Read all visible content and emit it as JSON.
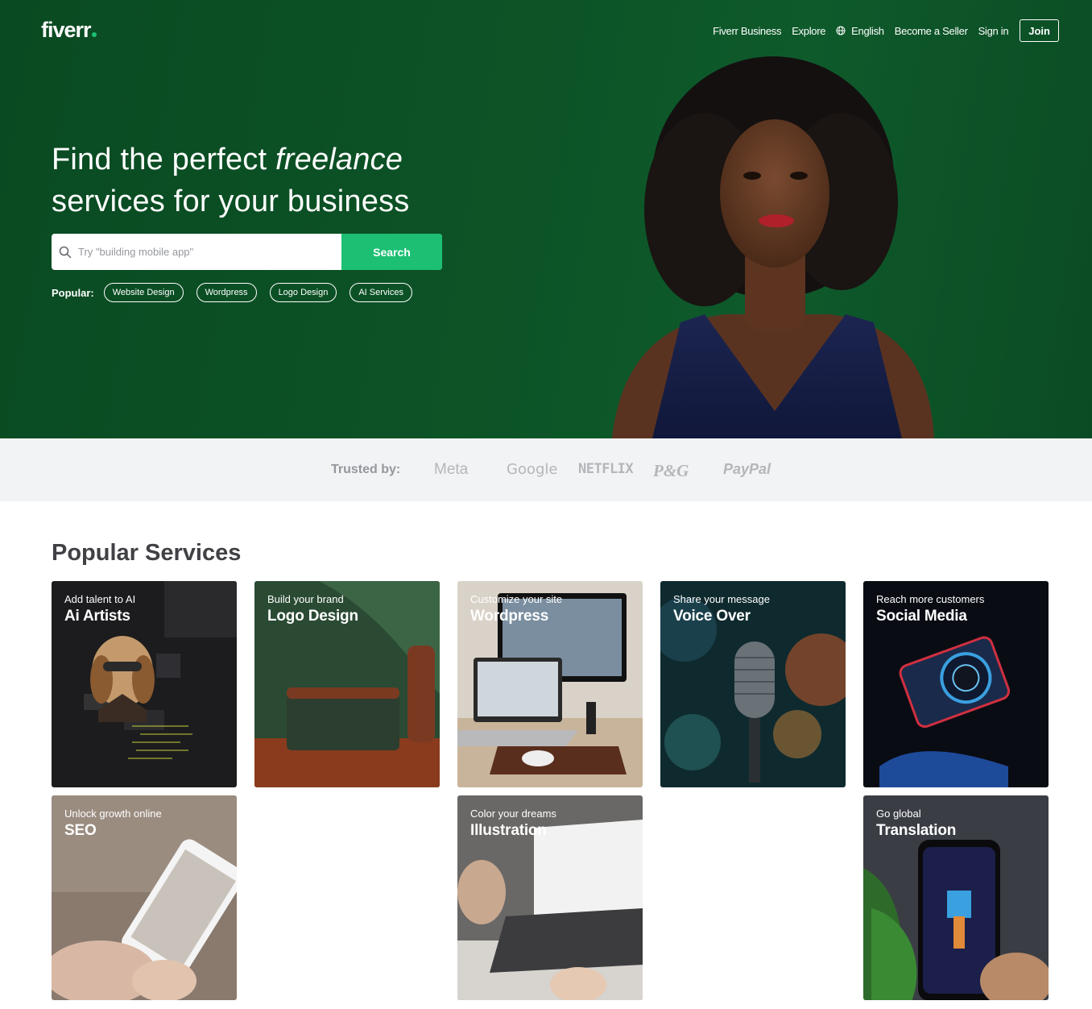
{
  "brand": {
    "logo_text": "fiverr",
    "accent": "#1dbf73",
    "hero_bg": "#0c5326"
  },
  "nav": {
    "links": [
      "Fiverr Business",
      "Explore",
      "English",
      "Become a Seller",
      "Sign in"
    ],
    "join_label": "Join",
    "language_icon": "globe-icon"
  },
  "hero": {
    "headline_part1": "Find the perfect ",
    "headline_em": "freelance",
    "headline_part2": "services for your business",
    "search_placeholder": "Try \"building mobile app\"",
    "search_button": "Search",
    "popular_label": "Popular:",
    "popular_tags": [
      "Website Design",
      "Wordpress",
      "Logo Design",
      "AI Services"
    ]
  },
  "trusted": {
    "label": "Trusted by:",
    "brands": [
      "Meta",
      "Google",
      "NETFLIX",
      "P&G",
      "PayPal"
    ]
  },
  "services": {
    "title": "Popular Services",
    "cards": [
      {
        "subtitle": "Add talent to AI",
        "title": "Ai Artists"
      },
      {
        "subtitle": "Build your brand",
        "title": "Logo Design"
      },
      {
        "subtitle": "Customize your site",
        "title": "Wordpress"
      },
      {
        "subtitle": "Share your message",
        "title": "Voice Over"
      },
      {
        "subtitle": "Reach more customers",
        "title": "Social Media"
      },
      {
        "subtitle": "Unlock growth online",
        "title": "SEO"
      },
      {
        "subtitle": "Color your dreams",
        "title": "Illustration"
      },
      {
        "subtitle": "Go global",
        "title": "Translation"
      }
    ]
  }
}
